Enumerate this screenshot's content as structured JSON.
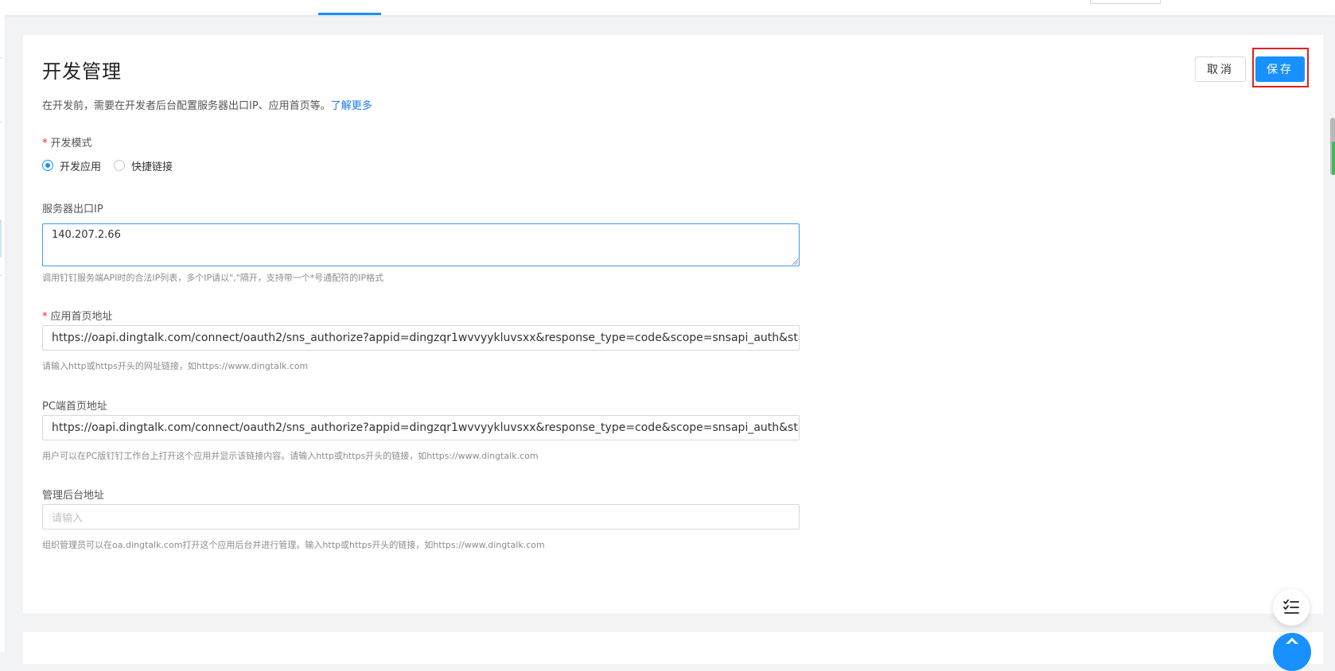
{
  "page": {
    "title": "开发管理",
    "description": "在开发前，需要在开发者后台配置服务器出口IP、应用首页等。",
    "learn_more": "了解更多"
  },
  "actions": {
    "cancel_label": "取消",
    "save_label": "保存"
  },
  "dev_mode": {
    "required_mark": "*",
    "label": "开发模式",
    "options": [
      {
        "label": "开发应用",
        "selected": true
      },
      {
        "label": "快捷链接",
        "selected": false
      }
    ]
  },
  "server_ip": {
    "label": "服务器出口IP",
    "value": "140.207.2.66",
    "help": "调用钉钉服务端API时的合法IP列表，多个IP请以\",\"隔开，支持带一个*号通配符的IP格式"
  },
  "home_url": {
    "required_mark": "*",
    "label": "应用首页地址",
    "value": "https://oapi.dingtalk.com/connect/oauth2/sns_authorize?appid=dingzqr1wvvyykluvsxx&response_type=code&scope=snsapi_auth&state=",
    "help": "请输入http或https开头的网址链接，如https://www.dingtalk.com"
  },
  "pc_home_url": {
    "label": "PC端首页地址",
    "value": "https://oapi.dingtalk.com/connect/oauth2/sns_authorize?appid=dingzqr1wvvyykluvsxx&response_type=code&scope=snsapi_auth&state=",
    "help": "用户可以在PC版钉钉工作台上打开这个应用并显示该链接内容。请输入http或https开头的链接，如https://www.dingtalk.com"
  },
  "admin_url": {
    "label": "管理后台地址",
    "placeholder": "请输入",
    "help": "组织管理员可以在oa.dingtalk.com打开这个应用后台并进行管理。输入http或https开头的链接，如https://www.dingtalk.com"
  },
  "icons": {
    "fab_outline": "list-checks-icon",
    "fab_blue": "assistant-icon"
  },
  "colors": {
    "primary": "#1890ff",
    "required": "#f5222d",
    "highlight": "#e0211d"
  }
}
